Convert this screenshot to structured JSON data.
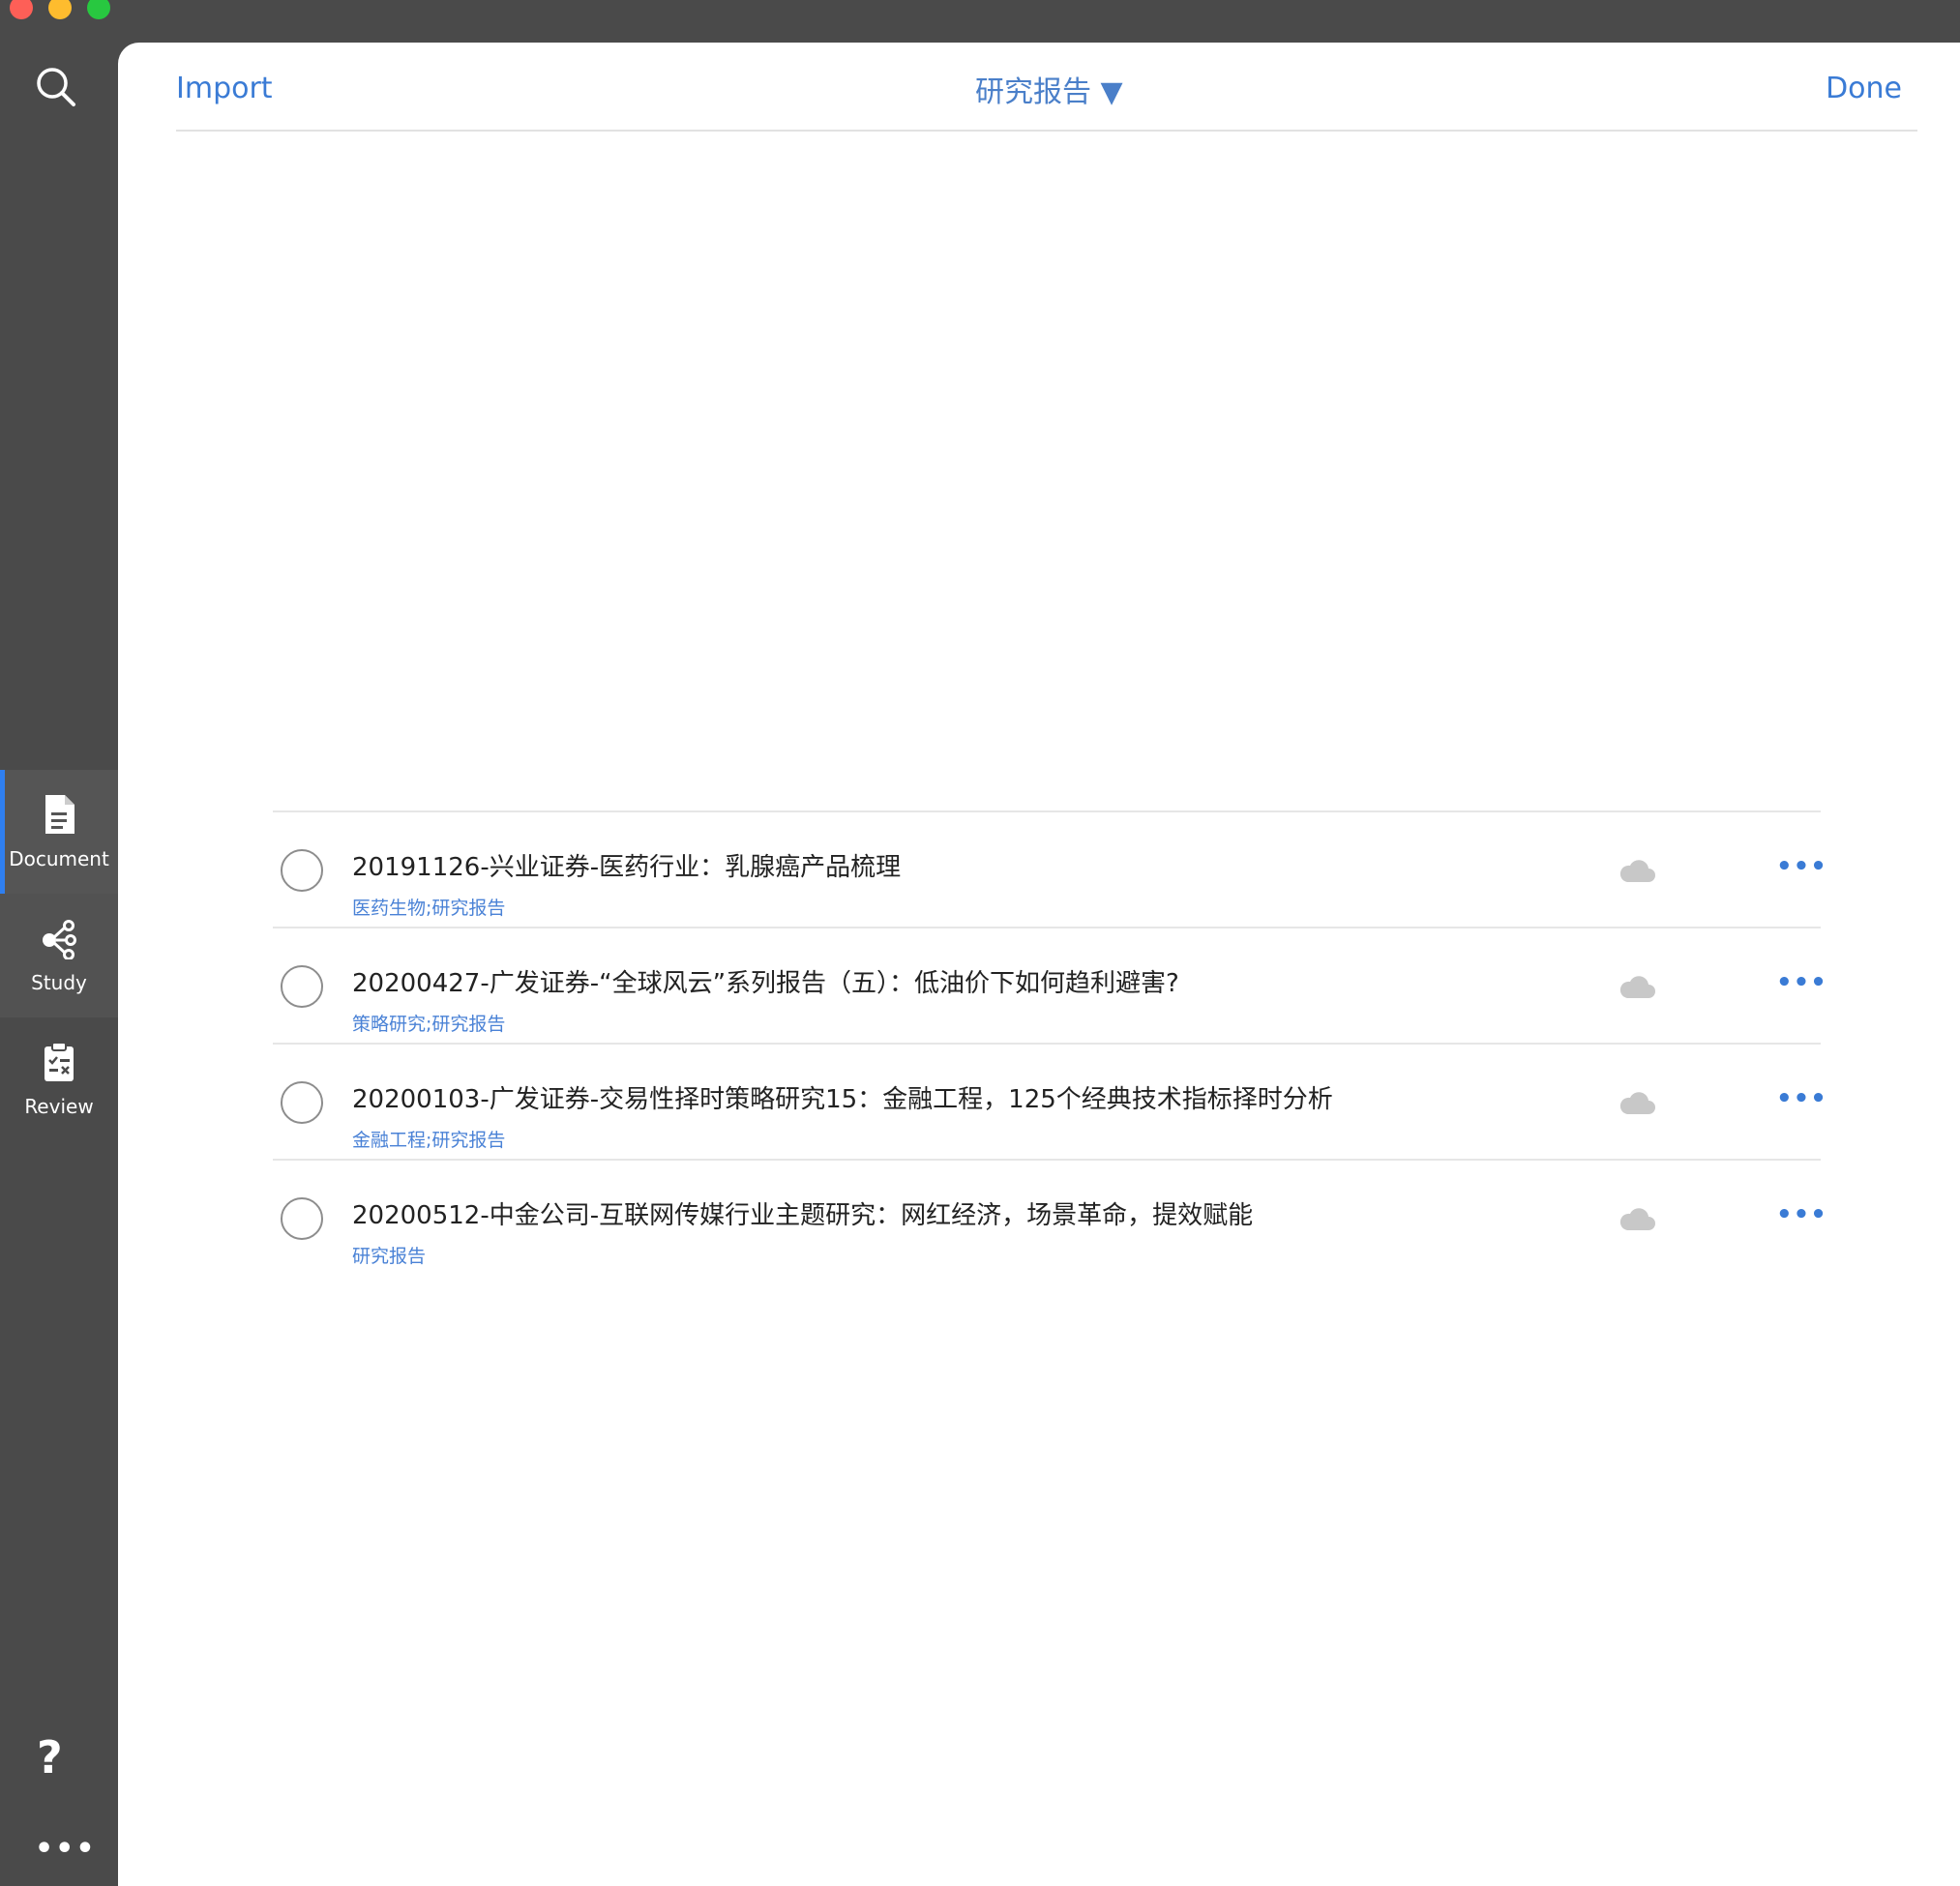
{
  "window": {
    "traffic_lights": [
      "close",
      "minimize",
      "zoom"
    ]
  },
  "sidebar": {
    "search_icon": "search-icon",
    "nav": [
      {
        "label": "Document",
        "icon": "document-icon",
        "active": true
      },
      {
        "label": "Study",
        "icon": "mindmap-icon",
        "active": false
      },
      {
        "label": "Review",
        "icon": "clipboard-check-icon",
        "active": false
      }
    ],
    "help_label": "?",
    "more_label": "•••"
  },
  "header": {
    "import_label": "Import",
    "title": "研究报告",
    "title_caret": "▼",
    "done_label": "Done"
  },
  "documents": [
    {
      "title": "20191126-兴业证券-医药行业：乳腺癌产品梳理",
      "tags": "医药生物;研究报告"
    },
    {
      "title": "20200427-广发证券-“全球风云”系列报告（五）：低油价下如何趋利避害?",
      "tags": "策略研究;研究报告"
    },
    {
      "title": "20200103-广发证券-交易性择时策略研究15：金融工程，125个经典技术指标择时分析",
      "tags": "金融工程;研究报告"
    },
    {
      "title": "20200512-中金公司-互联网传媒行业主题研究：网红经济，场景革命，提效赋能",
      "tags": "研究报告"
    }
  ],
  "row_more_label": "•••",
  "colors": {
    "accent": "#3a7bd5",
    "sidebar_bg": "#4a4a4a",
    "active_indicator": "#2f7ff0",
    "cloud": "#c8c8c8"
  }
}
